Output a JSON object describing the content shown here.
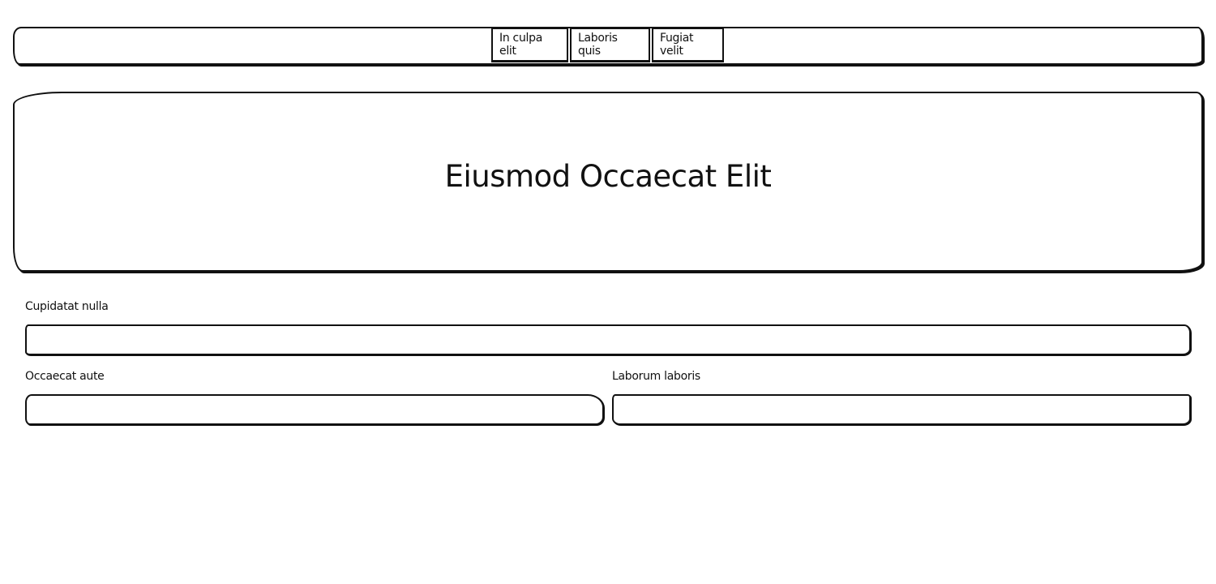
{
  "nav": {
    "links": [
      "In culpa elit",
      "Laboris quis",
      "Fugiat velit"
    ]
  },
  "hero": {
    "title": "Eiusmod Occaecat Elit"
  },
  "form": {
    "fields": [
      {
        "label": "Cupidatat nulla",
        "value": "",
        "placeholder": ""
      },
      {
        "label": "Occaecat aute",
        "value": "",
        "placeholder": ""
      },
      {
        "label": "Laborum laboris",
        "value": "",
        "placeholder": ""
      }
    ]
  }
}
